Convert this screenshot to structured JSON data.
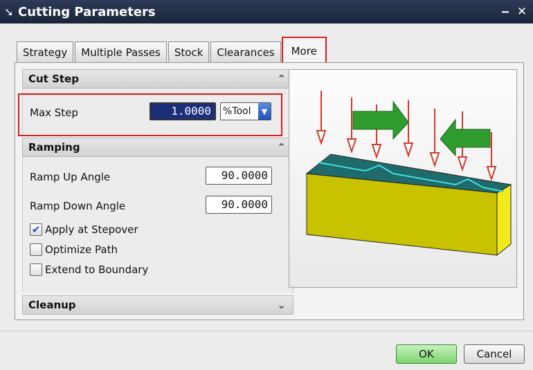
{
  "window": {
    "title": "Cutting Parameters",
    "minimize_label": "‒",
    "close_label": "✕"
  },
  "tabs": [
    {
      "label": "Strategy"
    },
    {
      "label": "Multiple Passes"
    },
    {
      "label": "Stock"
    },
    {
      "label": "Clearances"
    },
    {
      "label": "More",
      "active": true
    }
  ],
  "cut_step": {
    "header": "Cut Step",
    "max_step_label": "Max Step",
    "max_step_value": "1.0000",
    "unit": "%Tool"
  },
  "ramping": {
    "header": "Ramping",
    "ramp_up_label": "Ramp Up Angle",
    "ramp_up_value": "90.0000",
    "ramp_down_label": "Ramp Down Angle",
    "ramp_down_value": "90.0000",
    "apply_stepover_label": "Apply at Stepover",
    "apply_stepover_checked": true,
    "optimize_path_label": "Optimize Path",
    "optimize_path_checked": false,
    "extend_boundary_label": "Extend to Boundary",
    "extend_boundary_checked": false
  },
  "cleanup": {
    "header": "Cleanup"
  },
  "buttons": {
    "ok": "OK",
    "cancel": "Cancel"
  },
  "colors": {
    "highlight": "#e01818",
    "ok_green": "#7bd46c",
    "selection": "#1d2f79"
  }
}
